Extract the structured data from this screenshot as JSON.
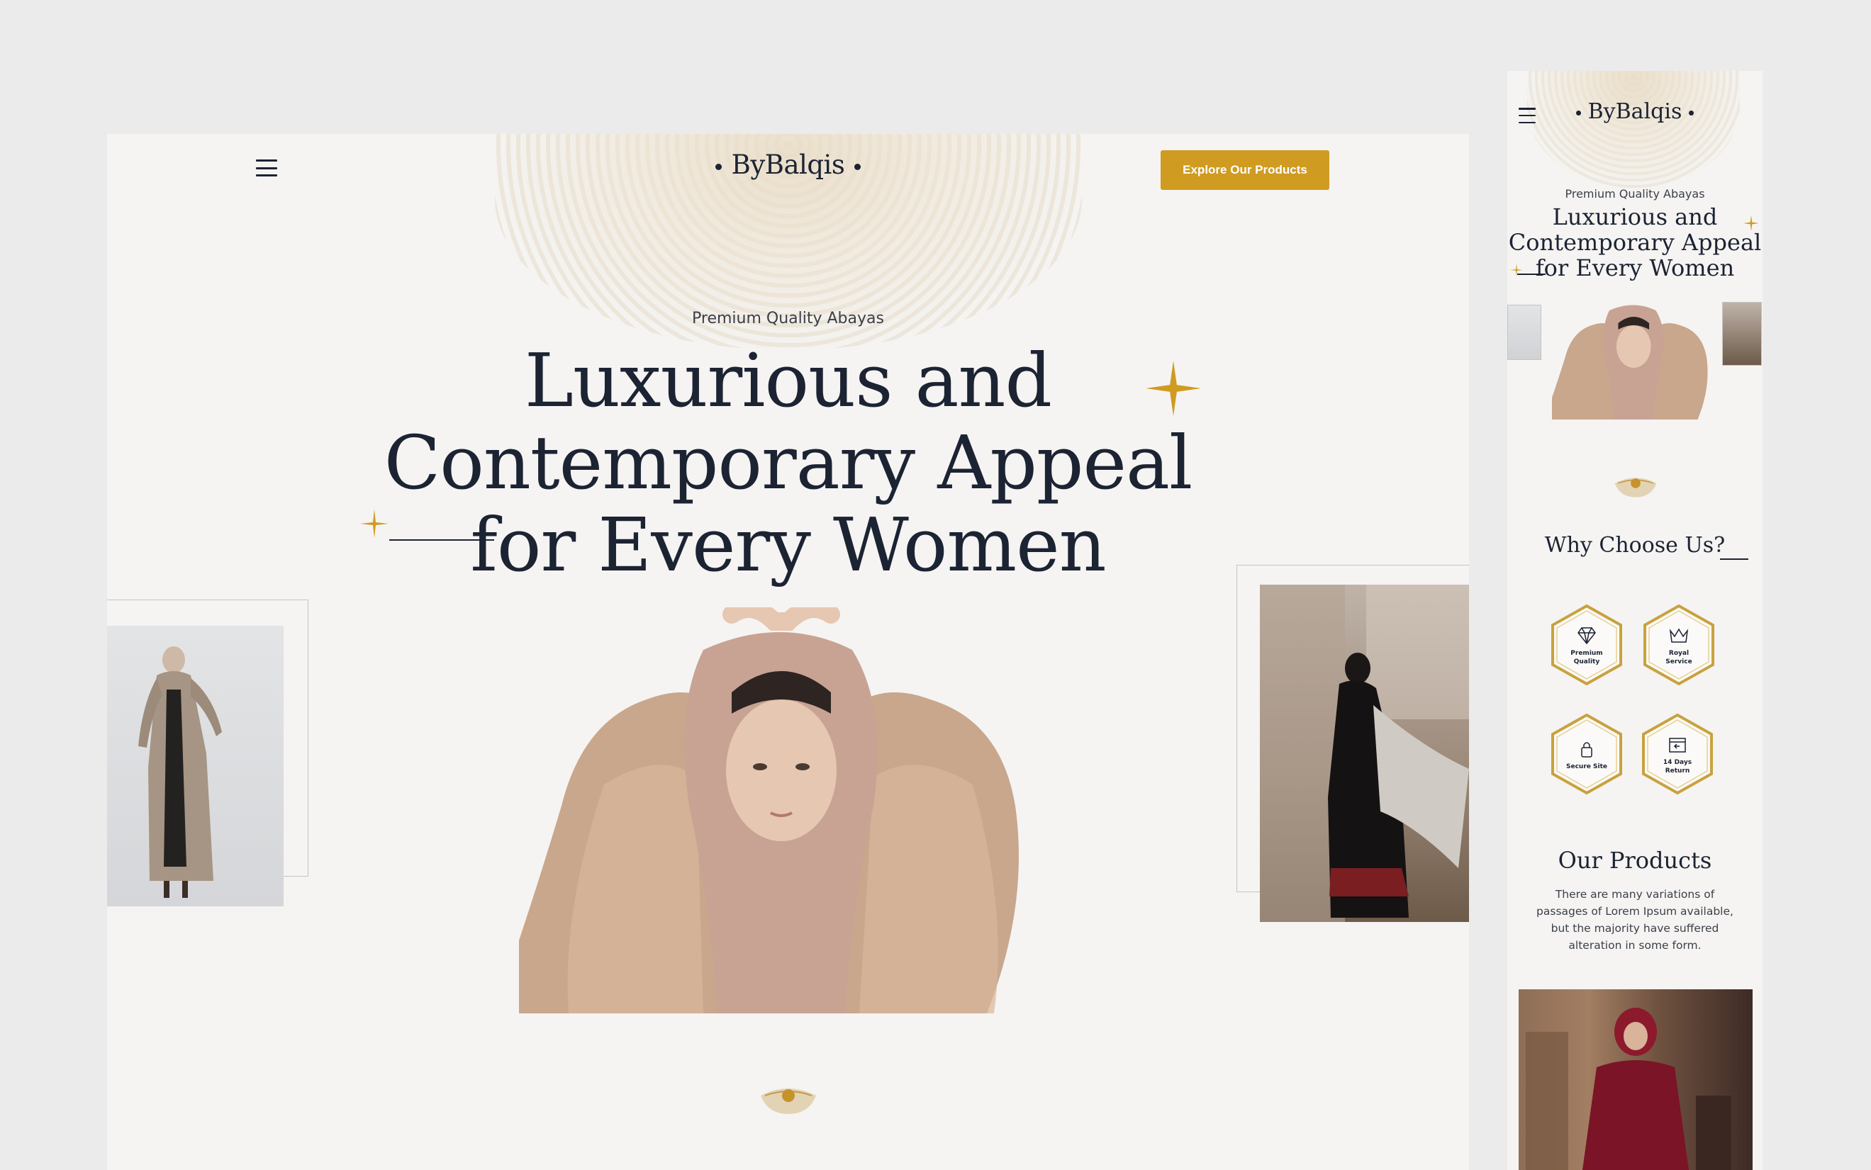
{
  "brand": {
    "name": "ByBalqis",
    "accent": "#d09b21",
    "ink": "#1c2333",
    "background": "#f5f4f2"
  },
  "desktop": {
    "nav": {
      "menu_icon": "hamburger-menu-icon",
      "cta_label": "Explore Our Products"
    },
    "hero": {
      "eyebrow": "Premium Quality Abayas",
      "headline_line1": "Luxurious and",
      "headline_line2": "Contemporary Appeal",
      "headline_line3": "for Every Women"
    }
  },
  "mobile": {
    "hero": {
      "eyebrow": "Premium Quality Abayas",
      "headline_line1": "Luxurious and",
      "headline_line2": "Contemporary Appeal",
      "headline_line3": "for Every Women"
    },
    "why": {
      "title": "Why Choose Us?",
      "features": [
        {
          "label": "Premium Quality",
          "icon": "diamond-icon"
        },
        {
          "label": "Royal Service",
          "icon": "crown-icon"
        },
        {
          "label": "Secure Site",
          "icon": "lock-icon"
        },
        {
          "label": "14 Days Return",
          "icon": "return-box-icon"
        }
      ]
    },
    "products": {
      "title": "Our Products",
      "description": "There are many variations of passages of Lorem Ipsum available, but the majority have suffered alteration in some form."
    }
  }
}
